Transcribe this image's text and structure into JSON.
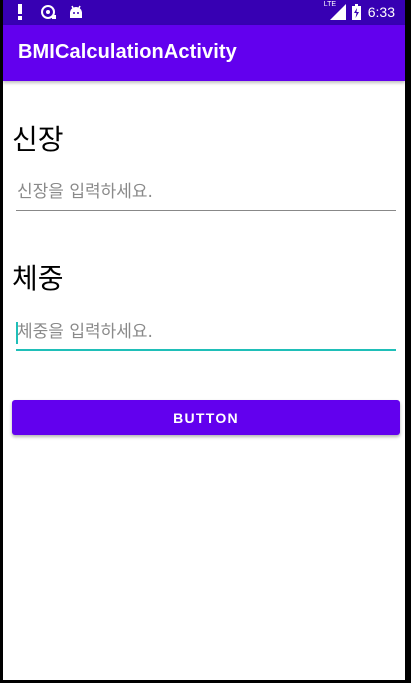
{
  "status_bar": {
    "time": "6:33",
    "network_label": "LTE",
    "icons": [
      "alert-icon",
      "sync-icon",
      "android-icon",
      "signal-icon",
      "battery-icon"
    ]
  },
  "app_bar": {
    "title": "BMICalculationActivity"
  },
  "height": {
    "label": "신장",
    "placeholder": "신장을 입력하세요.",
    "value": ""
  },
  "weight": {
    "label": "체중",
    "placeholder": "체중을 입력하세요.",
    "value": ""
  },
  "button": {
    "label": "BUTTON"
  },
  "colors": {
    "status_bar": "#3700b3",
    "primary": "#6200ee",
    "accent": "#1fbfb8"
  }
}
